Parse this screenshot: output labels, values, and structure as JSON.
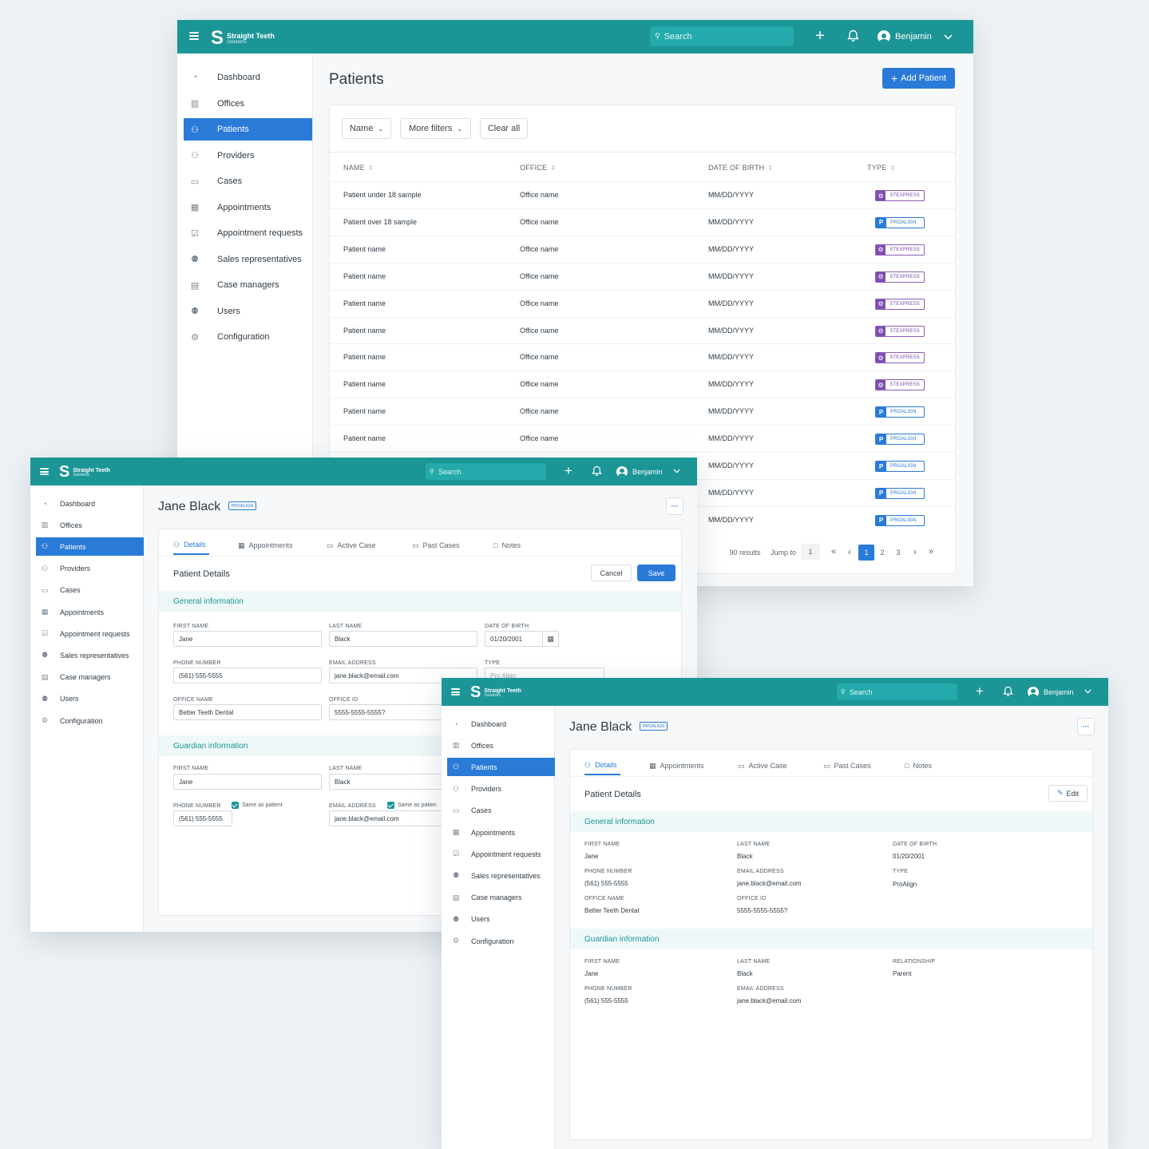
{
  "brand": {
    "name": "Straight Teeth",
    "sub": "Solutions"
  },
  "user": {
    "name": "Benjamin"
  },
  "search": {
    "placeholder": "Search"
  },
  "nav": [
    {
      "label": "Dashboard",
      "icon": "dashboard-icon"
    },
    {
      "label": "Offices",
      "icon": "building-icon"
    },
    {
      "label": "Patients",
      "icon": "person-icon"
    },
    {
      "label": "Providers",
      "icon": "provider-icon"
    },
    {
      "label": "Cases",
      "icon": "folder-icon"
    },
    {
      "label": "Appointments",
      "icon": "calendar-icon"
    },
    {
      "label": "Appointment requests",
      "icon": "calendar-check-icon"
    },
    {
      "label": "Sales representatives",
      "icon": "sales-rep-icon"
    },
    {
      "label": "Case managers",
      "icon": "clipboard-icon"
    },
    {
      "label": "Users",
      "icon": "users-icon"
    },
    {
      "label": "Configuration",
      "icon": "gears-icon"
    }
  ],
  "list": {
    "title": "Patients",
    "add_label": "Add Patient",
    "filters": {
      "name": "Name",
      "more": "More filters",
      "clear": "Clear all"
    },
    "columns": [
      "NAME",
      "OFFICE",
      "DATE OF BIRTH",
      "TYPE"
    ],
    "rows": [
      {
        "name": "Patient under 18 sample",
        "office": "Office name",
        "dob": "MM/DD/YYYY",
        "type": "STEXPRESS"
      },
      {
        "name": "Patient over 18 sample",
        "office": "Office name",
        "dob": "MM/DD/YYYY",
        "type": "PROALIGN"
      },
      {
        "name": "Patient name",
        "office": "Office name",
        "dob": "MM/DD/YYYY",
        "type": "STEXPRESS"
      },
      {
        "name": "Patient name",
        "office": "Office name",
        "dob": "MM/DD/YYYY",
        "type": "STEXPRESS"
      },
      {
        "name": "Patient name",
        "office": "Office name",
        "dob": "MM/DD/YYYY",
        "type": "STEXPRESS"
      },
      {
        "name": "Patient name",
        "office": "Office name",
        "dob": "MM/DD/YYYY",
        "type": "STEXPRESS"
      },
      {
        "name": "Patient name",
        "office": "Office name",
        "dob": "MM/DD/YYYY",
        "type": "STEXPRESS"
      },
      {
        "name": "Patient name",
        "office": "Office name",
        "dob": "MM/DD/YYYY",
        "type": "STEXPRESS"
      },
      {
        "name": "Patient name",
        "office": "Office name",
        "dob": "MM/DD/YYYY",
        "type": "PROALIGN"
      },
      {
        "name": "Patient name",
        "office": "Office name",
        "dob": "MM/DD/YYYY",
        "type": "PROALIGN"
      },
      {
        "name": "",
        "office": "",
        "dob": "MM/DD/YYYY",
        "type": "PROALIGN"
      },
      {
        "name": "",
        "office": "",
        "dob": "MM/DD/YYYY",
        "type": "PROALIGN"
      },
      {
        "name": "",
        "office": "",
        "dob": "MM/DD/YYYY",
        "type": "PROALIGN"
      }
    ],
    "pagination": {
      "results": "90 results",
      "jump_label": "Jump to",
      "jump_value": "1",
      "pages": [
        "1",
        "2",
        "3"
      ],
      "first": "«",
      "prev": "‹",
      "next": "›",
      "last": "»"
    }
  },
  "patient": {
    "name": "Jane Black",
    "type_badge": "PROALIGN",
    "more": "···",
    "tabs": [
      "Details",
      "Appointments",
      "Active Case",
      "Past Cases",
      "Notes"
    ],
    "details_title": "Patient Details",
    "cancel": "Cancel",
    "save": "Save",
    "edit": "Edit",
    "general_title": "General information",
    "guardian_title": "Guardian information",
    "labels": {
      "first_name": "FIRST NAME",
      "last_name": "LAST NAME",
      "dob": "DATE OF BIRTH",
      "phone": "PHONE NUMBER",
      "email": "EMAIL ADDRESS",
      "type": "TYPE",
      "office_name": "OFFICE NAME",
      "office_id": "OFFICE ID",
      "relationship": "RELATIONSHIP"
    },
    "general": {
      "first_name": "Jane",
      "last_name": "Black",
      "dob": "01/20/2001",
      "phone": "(561) 555-5555",
      "email": "jane.black@email.com",
      "type": "ProAlign",
      "type_partial": "Pro Align",
      "office_name": "Better Teeth Dental",
      "office_id": "5555-5555-5555?"
    },
    "guardian": {
      "first_name": "Jane",
      "last_name": "Black",
      "relationship": "Parent",
      "phone": "(561) 555-5555",
      "email": "jane.black@email.com"
    },
    "same_as_patient": "Same as patient",
    "same_as_patient_cut": "Same as patien"
  }
}
